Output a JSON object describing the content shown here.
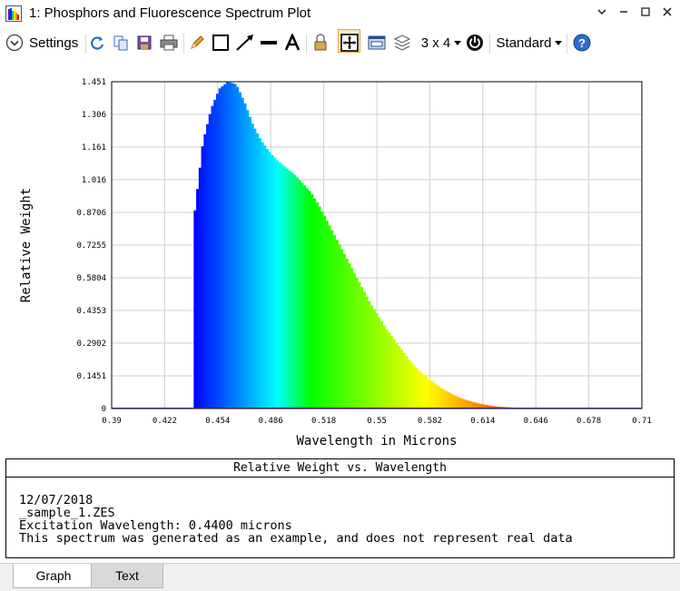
{
  "window": {
    "title": "1: Phosphors and Fluorescence Spectrum Plot"
  },
  "toolbar": {
    "settings_label": "Settings",
    "layout_label": "3 x 4",
    "style_label": "Standard"
  },
  "chart_data": {
    "type": "area",
    "xlabel": "Wavelength in Microns",
    "ylabel": "Relative Weight",
    "xlim": [
      0.39,
      0.71
    ],
    "ylim": [
      0,
      1.451
    ],
    "x_ticks": [
      "0.39",
      "0.422",
      "0.454",
      "0.486",
      "0.518",
      "0.55",
      "0.582",
      "0.614",
      "0.646",
      "0.678",
      "0.71"
    ],
    "y_ticks": [
      "0",
      "0.1451",
      "0.2902",
      "0.4353",
      "0.5804",
      "0.7255",
      "0.8706",
      "1.016",
      "1.161",
      "1.306",
      "1.451"
    ],
    "grid": true,
    "series": [
      {
        "x": [
          0.39,
          0.44,
          0.4401,
          0.445,
          0.45,
          0.455,
          0.46,
          0.465,
          0.47,
          0.475,
          0.48,
          0.485,
          0.49,
          0.495,
          0.5,
          0.505,
          0.51,
          0.515,
          0.52,
          0.525,
          0.53,
          0.535,
          0.54,
          0.545,
          0.55,
          0.555,
          0.56,
          0.565,
          0.57,
          0.575,
          0.58,
          0.585,
          0.59,
          0.595,
          0.6,
          0.605,
          0.61,
          0.615,
          0.62,
          0.625,
          0.63,
          0.635,
          0.64,
          0.645,
          0.65,
          0.66,
          0.67,
          0.68,
          0.69,
          0.71
        ],
        "y": [
          0,
          0,
          0.87,
          1.18,
          1.33,
          1.42,
          1.45,
          1.44,
          1.36,
          1.26,
          1.19,
          1.14,
          1.1,
          1.07,
          1.04,
          1.0,
          0.96,
          0.9,
          0.83,
          0.76,
          0.69,
          0.62,
          0.55,
          0.48,
          0.42,
          0.36,
          0.31,
          0.26,
          0.21,
          0.17,
          0.14,
          0.11,
          0.085,
          0.065,
          0.048,
          0.035,
          0.025,
          0.017,
          0.011,
          0.007,
          0.005,
          0.003,
          0.002,
          0.0015,
          0.001,
          0.0005,
          0.0003,
          0.0002,
          0.0001,
          0
        ]
      }
    ]
  },
  "caption": {
    "title": "Relative Weight vs. Wavelength",
    "date": "12/07/2018",
    "file": "_sample_1.ZES",
    "excitation": "Excitation Wavelength: 0.4400 microns",
    "note": "This spectrum was generated as an example, and does not represent real data"
  },
  "tabs": [
    {
      "label": "Graph"
    },
    {
      "label": "Text"
    }
  ]
}
